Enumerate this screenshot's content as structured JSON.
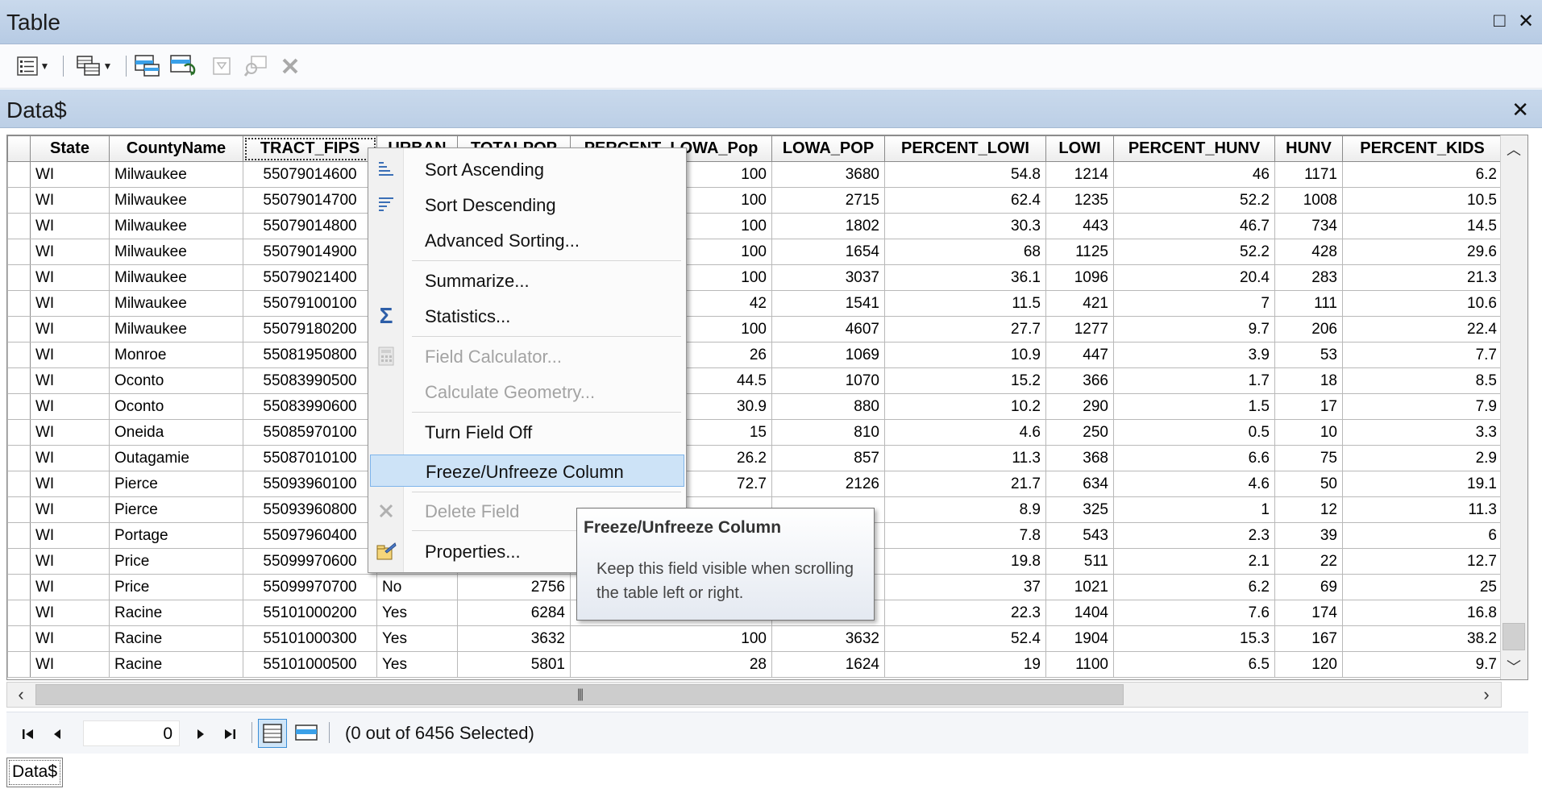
{
  "window": {
    "title": "Table",
    "restore_glyph": "□",
    "close_glyph": "✕"
  },
  "tab": {
    "title": "Data$",
    "close_glyph": "✕"
  },
  "columns": [
    "State",
    "CountyName",
    "TRACT_FIPS",
    "URBAN",
    "TOTALPOP",
    "PERCENT_LOWA_Pop",
    "LOWA_POP",
    "PERCENT_LOWI",
    "LOWI",
    "PERCENT_HUNV",
    "HUNV",
    "PERCENT_KIDS"
  ],
  "rows": [
    [
      "WI",
      "Milwaukee",
      "55079014600",
      "",
      "",
      "100",
      "3680",
      "54.8",
      "1214",
      "46",
      "1171",
      "6.2"
    ],
    [
      "WI",
      "Milwaukee",
      "55079014700",
      "",
      "",
      "100",
      "2715",
      "62.4",
      "1235",
      "52.2",
      "1008",
      "10.5"
    ],
    [
      "WI",
      "Milwaukee",
      "55079014800",
      "",
      "",
      "100",
      "1802",
      "30.3",
      "443",
      "46.7",
      "734",
      "14.5"
    ],
    [
      "WI",
      "Milwaukee",
      "55079014900",
      "",
      "",
      "100",
      "1654",
      "68",
      "1125",
      "52.2",
      "428",
      "29.6"
    ],
    [
      "WI",
      "Milwaukee",
      "55079021400",
      "",
      "",
      "100",
      "3037",
      "36.1",
      "1096",
      "20.4",
      "283",
      "21.3"
    ],
    [
      "WI",
      "Milwaukee",
      "55079100100",
      "",
      "",
      "42",
      "1541",
      "11.5",
      "421",
      "7",
      "111",
      "10.6"
    ],
    [
      "WI",
      "Milwaukee",
      "55079180200",
      "",
      "",
      "100",
      "4607",
      "27.7",
      "1277",
      "9.7",
      "206",
      "22.4"
    ],
    [
      "WI",
      "Monroe",
      "55081950800",
      "",
      "",
      "26",
      "1069",
      "10.9",
      "447",
      "3.9",
      "53",
      "7.7"
    ],
    [
      "WI",
      "Oconto",
      "55083990500",
      "",
      "",
      "44.5",
      "1070",
      "15.2",
      "366",
      "1.7",
      "18",
      "8.5"
    ],
    [
      "WI",
      "Oconto",
      "55083990600",
      "",
      "",
      "30.9",
      "880",
      "10.2",
      "290",
      "1.5",
      "17",
      "7.9"
    ],
    [
      "WI",
      "Oneida",
      "55085970100",
      "",
      "",
      "15",
      "810",
      "4.6",
      "250",
      "0.5",
      "10",
      "3.3"
    ],
    [
      "WI",
      "Outagamie",
      "55087010100",
      "",
      "",
      "26.2",
      "857",
      "11.3",
      "368",
      "6.6",
      "75",
      "2.9"
    ],
    [
      "WI",
      "Pierce",
      "55093960100",
      "",
      "",
      "72.7",
      "2126",
      "21.7",
      "634",
      "4.6",
      "50",
      "19.1"
    ],
    [
      "WI",
      "Pierce",
      "55093960800",
      "",
      "",
      "",
      "",
      "8.9",
      "325",
      "1",
      "12",
      "11.3"
    ],
    [
      "WI",
      "Portage",
      "55097960400",
      "",
      "",
      "",
      "",
      "7.8",
      "543",
      "2.3",
      "39",
      "6"
    ],
    [
      "WI",
      "Price",
      "55099970600",
      "",
      "",
      "",
      "",
      "19.8",
      "511",
      "2.1",
      "22",
      "12.7"
    ],
    [
      "WI",
      "Price",
      "55099970700",
      "No",
      "2756",
      "",
      "",
      "37",
      "1021",
      "6.2",
      "69",
      "25"
    ],
    [
      "WI",
      "Racine",
      "55101000200",
      "Yes",
      "6284",
      "",
      "",
      "22.3",
      "1404",
      "7.6",
      "174",
      "16.8"
    ],
    [
      "WI",
      "Racine",
      "55101000300",
      "Yes",
      "3632",
      "100",
      "3632",
      "52.4",
      "1904",
      "15.3",
      "167",
      "38.2"
    ],
    [
      "WI",
      "Racine",
      "55101000500",
      "Yes",
      "5801",
      "28",
      "1624",
      "19",
      "1100",
      "6.5",
      "120",
      "9.7"
    ]
  ],
  "context_menu": {
    "sort_ascending": "Sort Ascending",
    "sort_descending": "Sort Descending",
    "advanced_sorting": "Advanced Sorting...",
    "summarize": "Summarize...",
    "statistics": "Statistics...",
    "field_calculator": "Field Calculator...",
    "calculate_geometry": "Calculate Geometry...",
    "turn_field_off": "Turn Field Off",
    "freeze_unfreeze": "Freeze/Unfreeze Column",
    "delete_field": "Delete Field",
    "properties": "Properties..."
  },
  "tooltip": {
    "title": "Freeze/Unfreeze Column",
    "body": "Keep this field visible when scrolling the table left or right."
  },
  "nav": {
    "record_value": "0",
    "status": "(0 out of 6456 Selected)"
  },
  "bottom_tab": {
    "label": "Data$"
  },
  "icons": {
    "table_options": "table-options-icon",
    "related_tables": "related-tables-icon",
    "select_by_attributes": "select-by-attributes-icon",
    "switch_selection": "switch-selection-icon",
    "clear_selection": "clear-selection-icon",
    "zoom_to_selected": "zoom-to-selected-icon",
    "delete_selected": "delete-selected-icon"
  },
  "colors": {
    "header_blue": "#c4d6ec",
    "highlight": "#cde3f7",
    "highlight_border": "#7eb4ea"
  }
}
